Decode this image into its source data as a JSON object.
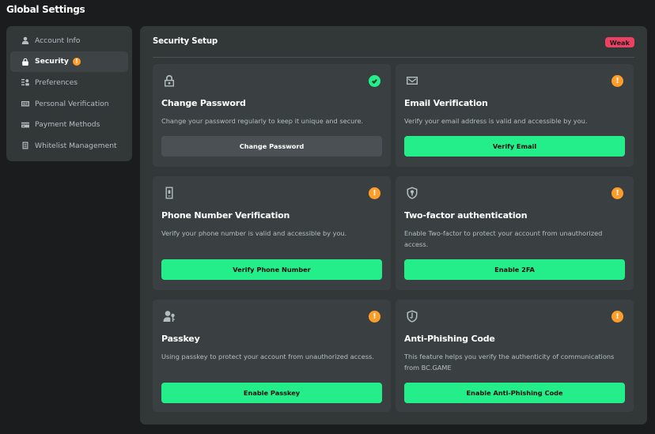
{
  "page_title": "Global Settings",
  "sidebar": {
    "items": [
      {
        "label": "Account Info",
        "icon": "user-icon"
      },
      {
        "label": "Security",
        "icon": "lock-icon",
        "active": true,
        "warning": "!"
      },
      {
        "label": "Preferences",
        "icon": "preferences-icon"
      },
      {
        "label": "Personal Verification",
        "icon": "id-card-icon"
      },
      {
        "label": "Payment Methods",
        "icon": "credit-card-icon"
      },
      {
        "label": "Whitelist Management",
        "icon": "list-icon"
      }
    ]
  },
  "main": {
    "title": "Security Setup",
    "strength_badge": "Weak",
    "cards": [
      {
        "title": "Change Password",
        "desc": "Change your password regularly to keep it unique and secure.",
        "button": "Change Password",
        "icon": "lock-icon",
        "status": "complete"
      },
      {
        "title": "Email Verification",
        "desc": "Verify your email address is valid and accessible by you.",
        "button": "Verify Email",
        "icon": "envelope-icon",
        "status": "warning"
      },
      {
        "title": "Phone Number Verification",
        "desc": "Verify your phone number is valid and accessible by you.",
        "button": "Verify Phone Number",
        "icon": "phone-icon",
        "status": "warning"
      },
      {
        "title": "Two-factor authentication",
        "desc": "Enable Two-factor to protect your account from unauthorized access.",
        "button": "Enable 2FA",
        "icon": "shield-key-icon",
        "status": "warning"
      },
      {
        "title": "Passkey",
        "desc": "Using passkey to protect your account from unauthorized access.",
        "button": "Enable Passkey",
        "icon": "user-key-icon",
        "status": "warning"
      },
      {
        "title": "Anti-Phishing Code",
        "desc": "This feature helps you verify the authenticity of communications from BC.GAME",
        "button": "Enable Anti-Phishing Code",
        "icon": "shield-hook-icon",
        "status": "warning"
      }
    ],
    "warning_glyph": "!"
  },
  "colors": {
    "accent": "#24ee89",
    "warning": "#ff9d2a",
    "danger": "#ed4163",
    "panel": "#323738",
    "card": "#3a4042",
    "background": "#1a1c1d"
  }
}
